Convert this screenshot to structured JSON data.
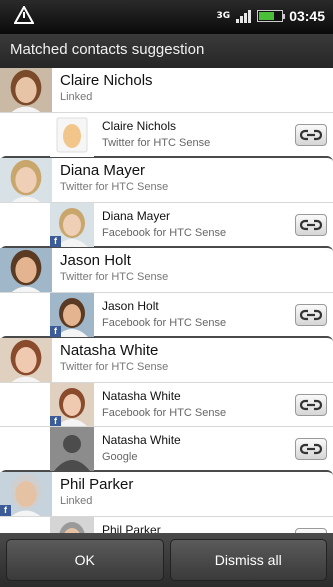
{
  "status_bar": {
    "network": "3G",
    "time": "03:45",
    "battery_level": 0.6
  },
  "dialog": {
    "title": "Matched contacts suggestion"
  },
  "contacts": [
    {
      "name": "Claire Nichols",
      "subtitle": "Linked",
      "avatar": {
        "hair": "#7a4a2a",
        "skin": "#e8c4a6",
        "bg": "#c9b9a5"
      },
      "links": [
        {
          "name": "Claire Nichols",
          "source": "Twitter for HTC Sense",
          "avatar": {
            "type": "egg"
          }
        }
      ]
    },
    {
      "name": "Diana Mayer",
      "subtitle": "Twitter for HTC Sense",
      "avatar": {
        "hair": "#c9a66b",
        "skin": "#efcfb5",
        "bg": "#d7e1e6"
      },
      "links": [
        {
          "name": "Diana Mayer",
          "source": "Facebook for HTC Sense",
          "avatar": {
            "type": "photo",
            "hair": "#c9a66b",
            "skin": "#efcfb5",
            "bg": "#d7e1e6"
          },
          "facebook": true
        }
      ]
    },
    {
      "name": "Jason Holt",
      "subtitle": "Twitter for HTC Sense",
      "avatar": {
        "hair": "#5a3a22",
        "skin": "#e3b48f",
        "bg": "#9fb7c9"
      },
      "links": [
        {
          "name": "Jason Holt",
          "source": "Facebook for HTC Sense",
          "avatar": {
            "type": "photo",
            "hair": "#5a3a22",
            "skin": "#e3b48f",
            "bg": "#9fb7c9"
          },
          "facebook": true
        }
      ]
    },
    {
      "name": "Natasha White",
      "subtitle": "Twitter for HTC Sense",
      "avatar": {
        "hair": "#8a4b2c",
        "skin": "#efcab0",
        "bg": "#dfd0c0"
      },
      "links": [
        {
          "name": "Natasha White",
          "source": "Facebook for HTC Sense",
          "avatar": {
            "type": "photo",
            "hair": "#8a4b2c",
            "skin": "#efcab0",
            "bg": "#dfd0c0"
          },
          "facebook": true
        },
        {
          "name": "Natasha White",
          "source": "Google",
          "avatar": {
            "type": "silhouette"
          }
        }
      ]
    },
    {
      "name": "Phil Parker",
      "subtitle": "Linked",
      "avatar": {
        "hair": "#cfcfcf",
        "skin": "#e6c2a4",
        "bg": "#c7d3dc"
      },
      "facebook": true,
      "links": [
        {
          "name": "Phil Parker",
          "source": "",
          "avatar": {
            "type": "photo",
            "hair": "#9a9a9a",
            "skin": "#e6c2a4",
            "bg": "#d5d5d5"
          }
        }
      ]
    }
  ],
  "buttons": {
    "ok": "OK",
    "dismiss": "Dismiss all"
  }
}
